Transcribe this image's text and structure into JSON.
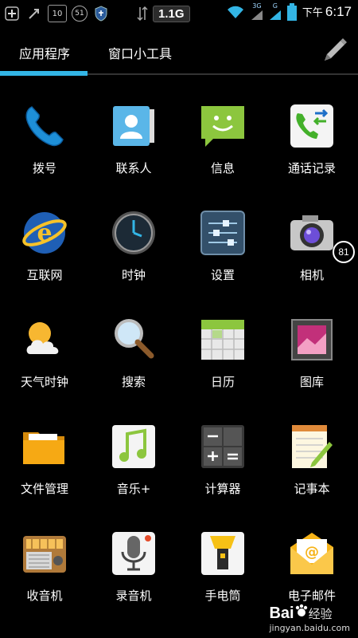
{
  "status": {
    "net_speed": "1.1G",
    "time_ampm": "下午",
    "time": "6:17",
    "badge_10": "10",
    "badge_51": "51",
    "net_3g": "3G",
    "net_g": "G"
  },
  "tabs": [
    {
      "label": "应用程序"
    },
    {
      "label": "窗口小工具"
    }
  ],
  "apps": [
    {
      "label": "拨号",
      "icon": "phone-icon"
    },
    {
      "label": "联系人",
      "icon": "contacts-icon"
    },
    {
      "label": "信息",
      "icon": "messaging-icon"
    },
    {
      "label": "通话记录",
      "icon": "call-log-icon"
    },
    {
      "label": "互联网",
      "icon": "browser-icon"
    },
    {
      "label": "时钟",
      "icon": "clock-icon"
    },
    {
      "label": "设置",
      "icon": "settings-icon"
    },
    {
      "label": "相机",
      "icon": "camera-icon"
    },
    {
      "label": "天气时钟",
      "icon": "weather-icon"
    },
    {
      "label": "搜索",
      "icon": "search-icon"
    },
    {
      "label": "日历",
      "icon": "calendar-icon"
    },
    {
      "label": "图库",
      "icon": "gallery-icon"
    },
    {
      "label": "文件管理",
      "icon": "folder-icon"
    },
    {
      "label": "音乐+",
      "icon": "music-icon"
    },
    {
      "label": "计算器",
      "icon": "calculator-icon"
    },
    {
      "label": "记事本",
      "icon": "notepad-icon"
    },
    {
      "label": "收音机",
      "icon": "radio-icon"
    },
    {
      "label": "录音机",
      "icon": "recorder-icon"
    },
    {
      "label": "手电筒",
      "icon": "flashlight-icon"
    },
    {
      "label": "电子邮件",
      "icon": "email-icon"
    }
  ],
  "camera_badge": "81",
  "watermark": {
    "brand": "Bai",
    "suffix": "经验",
    "url": "jingyan.baidu.com"
  },
  "colors": {
    "accent": "#33b5e5",
    "background": "#000000"
  }
}
